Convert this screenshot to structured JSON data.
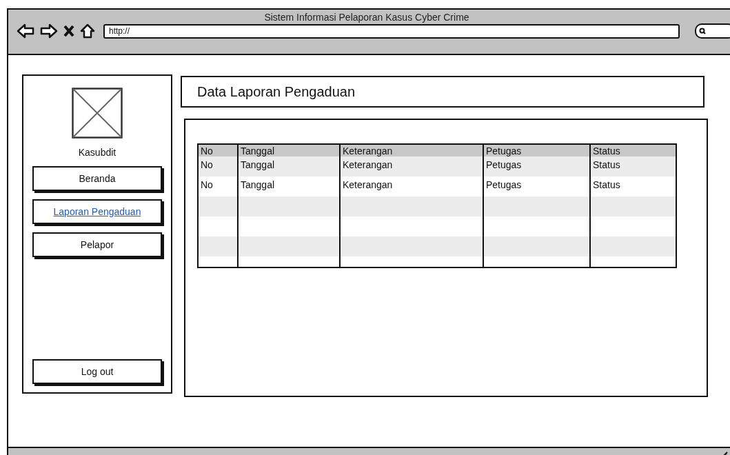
{
  "window": {
    "title": "Sistem Informasi Pelaporan Kasus Cyber Crime"
  },
  "address_bar": {
    "value": "http://"
  },
  "sidebar": {
    "user": "Kasubdit",
    "items": [
      {
        "label": "Beranda",
        "selected": false
      },
      {
        "label": "Laporan Pengaduan",
        "selected": true
      },
      {
        "label": "Pelapor",
        "selected": false
      }
    ],
    "logout": "Log out"
  },
  "page_title": "Data Laporan Pengaduan",
  "table": {
    "columns": [
      "No",
      "Tanggal",
      "Keterangan",
      "Petugas",
      "Status"
    ],
    "rows": [
      [
        "No",
        "Tanggal",
        "Keterangan",
        "Petugas",
        "Status"
      ],
      [
        "No",
        "Tanggal",
        "Keterangan",
        "Petugas",
        "Status"
      ]
    ]
  }
}
